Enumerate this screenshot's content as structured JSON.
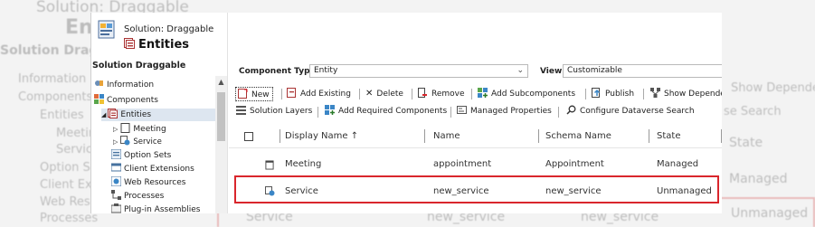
{
  "window": {
    "subtitle": "Solution: Draggable",
    "title": "Entities",
    "solution_name": "Solution Draggable"
  },
  "tree": [
    {
      "label": "Information",
      "icon": "information-icon"
    },
    {
      "label": "Components",
      "icon": "components-icon"
    },
    {
      "label": "Entities",
      "icon": "entities-icon",
      "selected": true,
      "expander": "◢"
    },
    {
      "label": "Meeting",
      "icon": "entity-icon",
      "expander": "▷"
    },
    {
      "label": "Service",
      "icon": "service-icon",
      "expander": "▷"
    },
    {
      "label": "Option Sets",
      "icon": "option-sets-icon"
    },
    {
      "label": "Client Extensions",
      "icon": "client-extensions-icon"
    },
    {
      "label": "Web Resources",
      "icon": "web-resources-icon"
    },
    {
      "label": "Processes",
      "icon": "processes-icon"
    },
    {
      "label": "Plug-in Assemblies",
      "icon": "plugin-assemblies-icon"
    }
  ],
  "filters": {
    "component_type_label": "Component Type",
    "component_type_value": "Entity",
    "view_label": "View",
    "view_value": "Customizable"
  },
  "toolbar": {
    "new": "New",
    "add_existing": "Add Existing",
    "delete": "Delete",
    "remove": "Remove",
    "add_subcomponents": "Add Subcomponents",
    "publish": "Publish",
    "show_dependencies": "Show Depende",
    "solution_layers": "Solution Layers",
    "add_required": "Add Required Components",
    "managed_properties": "Managed Properties",
    "configure_search": "Configure Dataverse Search"
  },
  "grid": {
    "columns": [
      "Display Name ↑",
      "Name",
      "Schema Name",
      "State"
    ],
    "rows": [
      {
        "display_name": "Meeting",
        "name": "appointment",
        "schema_name": "Appointment",
        "state": "Managed"
      },
      {
        "display_name": "Service",
        "name": "new_service",
        "schema_name": "new_service",
        "state": "Unmanaged"
      }
    ]
  },
  "background": {
    "header_sub": "Solution: Draggable",
    "header_title": "Enti",
    "solution_name": "Solution Draggable",
    "tree": [
      "Information",
      "Components",
      "Entities",
      "Meeting",
      "Service",
      "Option Se",
      "Client Exte",
      "Web Resour",
      "Processes"
    ],
    "show_dependencies": "Show Depende",
    "search": "se Search",
    "state_col": "State",
    "managed": "Managed",
    "service": "Service",
    "new_service_1": "new_service",
    "new_service_2": "new_service",
    "unmanaged": "Unmanaged"
  },
  "colors": {
    "accent_red": "#d9262c",
    "selection": "#dde6f0"
  }
}
